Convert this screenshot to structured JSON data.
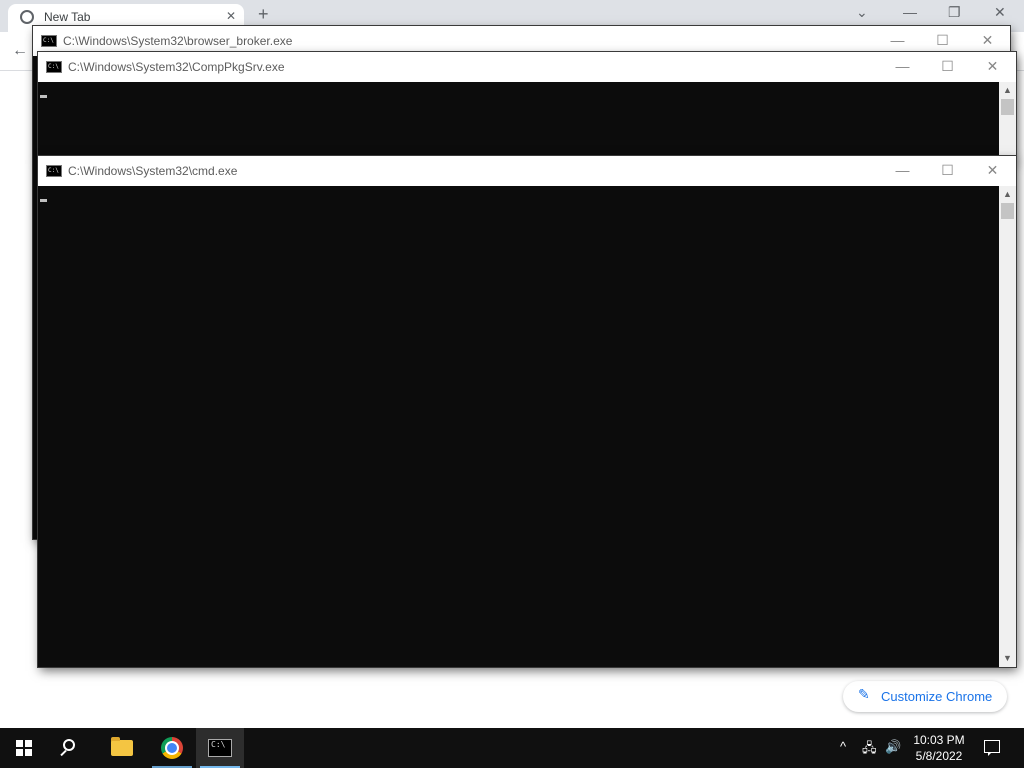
{
  "chrome": {
    "tab_title": "New Tab",
    "customize_label": "Customize Chrome"
  },
  "consoles": {
    "browser_broker": {
      "title": "C:\\Windows\\System32\\browser_broker.exe"
    },
    "comppkgsrv": {
      "title": "C:\\Windows\\System32\\CompPkgSrv.exe"
    },
    "cmd": {
      "title": "C:\\Windows\\System32\\cmd.exe"
    },
    "icon_glyph": "C:\\",
    "minimize_glyph": "—",
    "maximize_glyph": "☐",
    "close_glyph": "✕"
  },
  "taskbar": {
    "items": [
      "start-button",
      "search-icon",
      "file-explorer-icon",
      "chrome-icon",
      "command-prompt-icon"
    ],
    "tray_chevron": "^",
    "network_glyph": "🖧",
    "volume_glyph": "🔊",
    "time": "10:03 PM",
    "date": "5/8/2022",
    "accent_color": "#76b9ed"
  }
}
